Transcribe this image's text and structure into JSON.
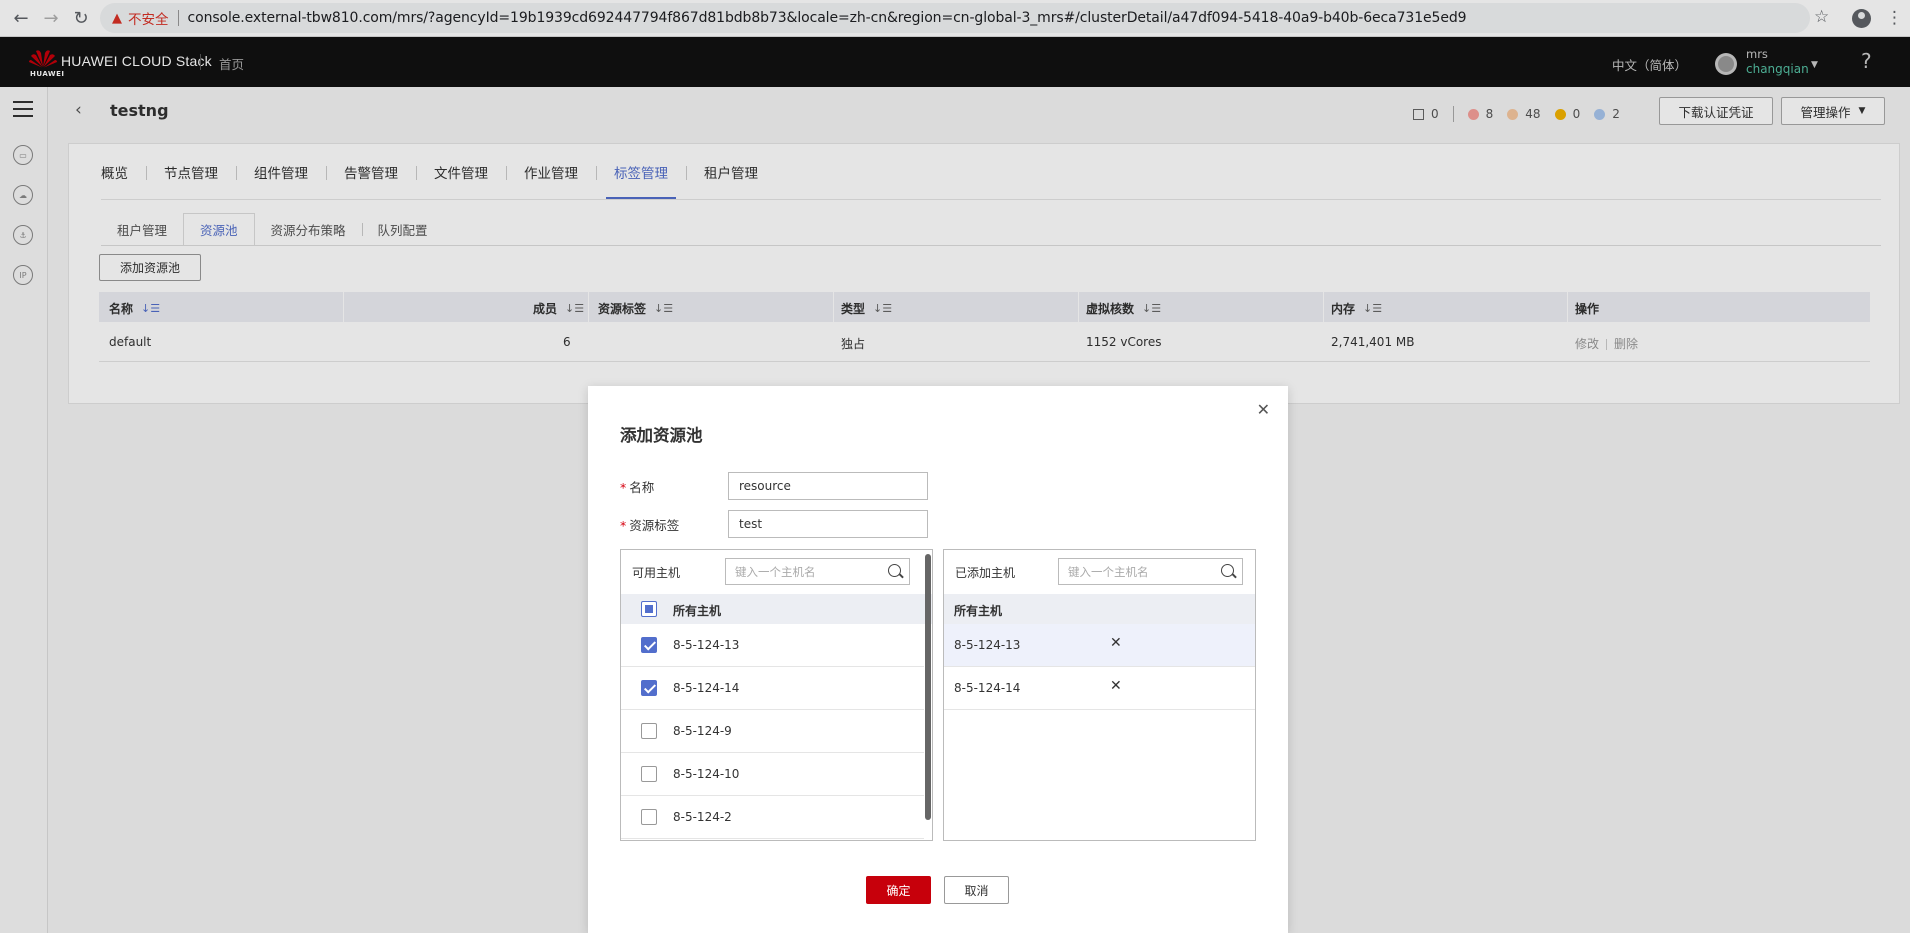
{
  "browser": {
    "insecure_label": "不安全",
    "url": "console.external-tbw810.com/mrs/?agencyId=19b1939cd692447794f867d81bdb8b73&locale=zh-cn&region=cn-global-3_mrs#/clusterDetail/a47df094-5418-40a9-b40b-6eca731e5ed9"
  },
  "header": {
    "brand": "HUAWEI CLOUD Stack",
    "logo_sub": "HUAWEI",
    "home": "首页",
    "language": "中文（简体）",
    "user_name": "mrs",
    "user_sub": "changqian",
    "brand_color": "#c7000b"
  },
  "page": {
    "title": "testng",
    "status": {
      "hosts": "0",
      "critical": "8",
      "major": "48",
      "minor": "0",
      "info": "2"
    },
    "status_colors": {
      "critical": "#f6a09a",
      "major": "#f7c8a0",
      "minor": "#f3b300",
      "info": "#a8c6ee"
    },
    "download_cred_btn": "下载认证凭证",
    "manage_btn": "管理操作"
  },
  "tabs": {
    "main": [
      "概览",
      "节点管理",
      "组件管理",
      "告警管理",
      "文件管理",
      "作业管理",
      "标签管理",
      "租户管理"
    ],
    "main_active": "标签管理",
    "sub": [
      "租户管理",
      "资源池",
      "资源分布策略",
      "队列配置"
    ],
    "sub_active": "资源池"
  },
  "pool": {
    "add_btn": "添加资源池",
    "columns": {
      "name": "名称",
      "members": "成员",
      "label": "资源标签",
      "type": "类型",
      "vcores": "虚拟核数",
      "memory": "内存",
      "ops": "操作"
    },
    "rows": [
      {
        "name": "default",
        "members": "6",
        "label": "",
        "type": "独占",
        "vcores": "1152 vCores",
        "memory": "2,741,401 MB",
        "edit": "修改",
        "delete": "删除"
      }
    ]
  },
  "dialog": {
    "title": "添加资源池",
    "name_label": "名称",
    "name_value": "resource",
    "tag_label": "资源标签",
    "tag_value": "test",
    "available": {
      "title": "可用主机",
      "search_placeholder": "键入一个主机名",
      "all_label": "所有主机",
      "hosts": [
        {
          "name": "8-5-124-13",
          "checked": true
        },
        {
          "name": "8-5-124-14",
          "checked": true
        },
        {
          "name": "8-5-124-9",
          "checked": false
        },
        {
          "name": "8-5-124-10",
          "checked": false
        },
        {
          "name": "8-5-124-2",
          "checked": false
        }
      ]
    },
    "added": {
      "title": "已添加主机",
      "search_placeholder": "键入一个主机名",
      "all_label": "所有主机",
      "hosts": [
        "8-5-124-13",
        "8-5-124-14"
      ]
    },
    "ok_btn": "确定",
    "cancel_btn": "取消"
  }
}
